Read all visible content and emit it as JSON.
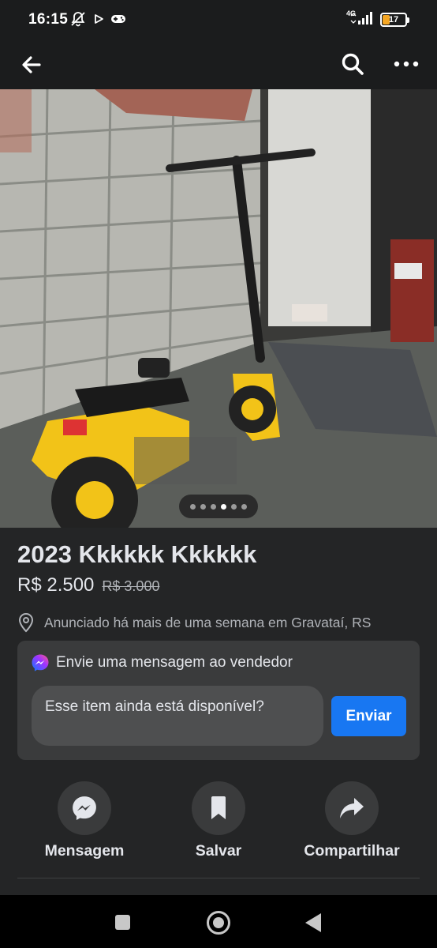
{
  "status_bar": {
    "time": "16:15",
    "network": "4G",
    "battery": "17",
    "icons": [
      "mute-bell-icon",
      "play-icon",
      "gamepad-icon",
      "signal-icon",
      "battery-icon"
    ]
  },
  "app_bar": {
    "icons": [
      "back-arrow-icon",
      "search-icon",
      "more-icon"
    ]
  },
  "gallery": {
    "photo_count": 6,
    "active_index": 3
  },
  "listing": {
    "title": "2023 Kkkkkk Kkkkkk",
    "price": "R$ 2.500",
    "old_price": "R$ 3.000",
    "location": "Anunciado há mais de uma semana em Gravataí, RS"
  },
  "message": {
    "title": "Envie uma mensagem ao vendedor",
    "input_value": "Esse item ainda está disponível?",
    "send_label": "Enviar"
  },
  "actions": [
    {
      "label": "Mensagem",
      "icon": "messenger-icon"
    },
    {
      "label": "Salvar",
      "icon": "bookmark-icon"
    },
    {
      "label": "Compartilhar",
      "icon": "share-icon"
    }
  ],
  "colors": {
    "background": "#242526",
    "card": "#3a3b3c",
    "accent": "#1877f2",
    "text_primary": "#e4e6eb",
    "text_secondary": "#b0b3b8"
  }
}
